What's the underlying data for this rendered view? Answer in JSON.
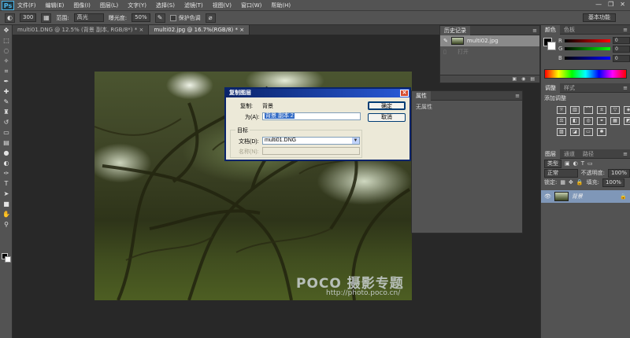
{
  "app": {
    "logo": "Ps"
  },
  "menu": [
    "文件(F)",
    "编辑(E)",
    "图像(I)",
    "图层(L)",
    "文字(Y)",
    "选择(S)",
    "滤镜(T)",
    "视图(V)",
    "窗口(W)",
    "帮助(H)"
  ],
  "window_controls": {
    "minimize": "—",
    "restore": "❐",
    "close": "✕"
  },
  "options": {
    "brush_size": "300",
    "range_label": "范围:",
    "range_value": "高光",
    "exposure_label": "曝光度:",
    "exposure_value": "50%",
    "protect_label": "保护色调",
    "workspace": "基本功能"
  },
  "tabs": [
    {
      "label": "multi01.DNG @ 12.5% (背景 副本, RGB/8*) *",
      "close": "×"
    },
    {
      "label": "multi02.jpg @ 16.7%(RGB/8) *",
      "close": "×"
    }
  ],
  "history": {
    "tab": "历史记录",
    "items": [
      {
        "label": "multi02.jpg"
      },
      {
        "label": "打开"
      }
    ]
  },
  "properties": {
    "tab": "属性",
    "body": "无属性"
  },
  "color_panel": {
    "tabs": [
      "颜色",
      "色板"
    ],
    "channels": [
      {
        "label": "R",
        "value": "0"
      },
      {
        "label": "G",
        "value": "0"
      },
      {
        "label": "B",
        "value": "0"
      }
    ]
  },
  "adjustments": {
    "tabs": [
      "调整",
      "样式"
    ],
    "heading": "添加调整"
  },
  "layers": {
    "tabs": [
      "图层",
      "通道",
      "路径"
    ],
    "kind_label": "类型",
    "blend_mode": "正常",
    "opacity_label": "不透明度:",
    "opacity_value": "100%",
    "lock_label": "锁定:",
    "fill_label": "填充:",
    "fill_value": "100%",
    "layer_name": "背景"
  },
  "dialog": {
    "title": "复制图层",
    "copy_label": "复制:",
    "copy_value": "背景",
    "as_label": "为(A):",
    "as_value": "背景 副本 2",
    "ok": "确定",
    "cancel": "取消",
    "group_title": "目标",
    "doc_label": "文档(D):",
    "doc_value": "multi01.DNG",
    "name_label": "名称(N):"
  },
  "watermark": {
    "brand": "POCO 摄影专题",
    "url": "http://photo.poco.cn/"
  }
}
